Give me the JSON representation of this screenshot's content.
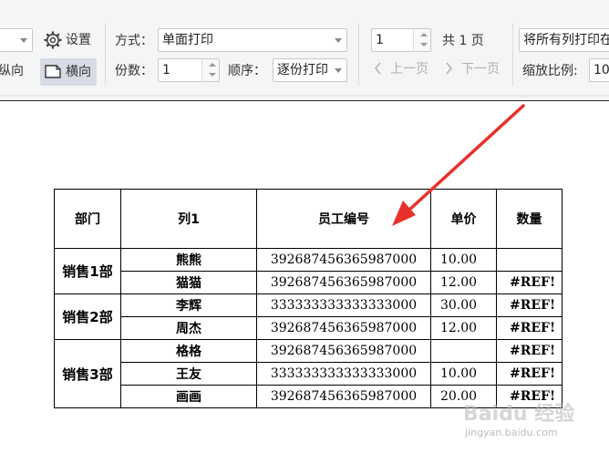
{
  "toolbar": {
    "settings_label": "设置",
    "portrait_label": "纵向",
    "landscape_label": "横向",
    "mode_label": "方式：",
    "mode_value": "单面打印",
    "copies_label": "份数：",
    "copies_value": "1",
    "order_label": "顺序：",
    "order_value": "逐份打印",
    "page_value": "1",
    "total_pages": "共 1 页",
    "prev_page": "上一页",
    "next_page": "下一页",
    "fit_value": "将所有列打印在",
    "scale_label": "缩放比例:",
    "scale_value": "10"
  },
  "sheet": {
    "headers": [
      "部门",
      "列1",
      "员工编号",
      "单价",
      "数量"
    ],
    "groups": [
      {
        "dept": "销售1部",
        "rows": [
          {
            "name": "熊熊",
            "id": "392687456365987000",
            "price": "10.00",
            "qty": ""
          },
          {
            "name": "猫猫",
            "id": "392687456365987000",
            "price": "12.00",
            "qty": "#REF!"
          }
        ]
      },
      {
        "dept": "销售2部",
        "rows": [
          {
            "name": "李辉",
            "id": "333333333333333000",
            "price": "30.00",
            "qty": "#REF!"
          },
          {
            "name": "周杰",
            "id": "392687456365987000",
            "price": "12.00",
            "qty": "#REF!"
          }
        ]
      },
      {
        "dept": "销售3部",
        "rows": [
          {
            "name": "格格",
            "id": "392687456365987000",
            "price": "",
            "qty": "#REF!"
          },
          {
            "name": "王友",
            "id": "333333333333333000",
            "price": "10.00",
            "qty": "#REF!"
          },
          {
            "name": "画画",
            "id": "392687456365987000",
            "price": "20.00",
            "qty": "#REF!"
          }
        ]
      }
    ]
  },
  "watermark": {
    "line1": "Baidu 经验",
    "line2": "jingyan.baidu.com"
  },
  "colors": {
    "arrow": "#e8312b",
    "toolbar_bg": "#f5f5f5",
    "active_button": "#d7dce4"
  }
}
